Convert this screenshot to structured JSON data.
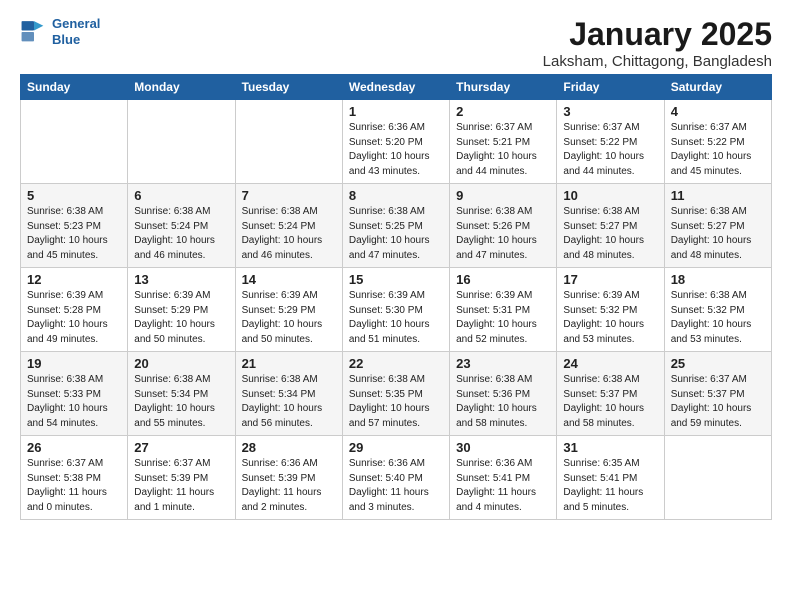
{
  "logo": {
    "line1": "General",
    "line2": "Blue"
  },
  "title": "January 2025",
  "subtitle": "Laksham, Chittagong, Bangladesh",
  "headers": [
    "Sunday",
    "Monday",
    "Tuesday",
    "Wednesday",
    "Thursday",
    "Friday",
    "Saturday"
  ],
  "weeks": [
    [
      {
        "day": "",
        "content": ""
      },
      {
        "day": "",
        "content": ""
      },
      {
        "day": "",
        "content": ""
      },
      {
        "day": "1",
        "content": "Sunrise: 6:36 AM\nSunset: 5:20 PM\nDaylight: 10 hours\nand 43 minutes."
      },
      {
        "day": "2",
        "content": "Sunrise: 6:37 AM\nSunset: 5:21 PM\nDaylight: 10 hours\nand 44 minutes."
      },
      {
        "day": "3",
        "content": "Sunrise: 6:37 AM\nSunset: 5:22 PM\nDaylight: 10 hours\nand 44 minutes."
      },
      {
        "day": "4",
        "content": "Sunrise: 6:37 AM\nSunset: 5:22 PM\nDaylight: 10 hours\nand 45 minutes."
      }
    ],
    [
      {
        "day": "5",
        "content": "Sunrise: 6:38 AM\nSunset: 5:23 PM\nDaylight: 10 hours\nand 45 minutes."
      },
      {
        "day": "6",
        "content": "Sunrise: 6:38 AM\nSunset: 5:24 PM\nDaylight: 10 hours\nand 46 minutes."
      },
      {
        "day": "7",
        "content": "Sunrise: 6:38 AM\nSunset: 5:24 PM\nDaylight: 10 hours\nand 46 minutes."
      },
      {
        "day": "8",
        "content": "Sunrise: 6:38 AM\nSunset: 5:25 PM\nDaylight: 10 hours\nand 47 minutes."
      },
      {
        "day": "9",
        "content": "Sunrise: 6:38 AM\nSunset: 5:26 PM\nDaylight: 10 hours\nand 47 minutes."
      },
      {
        "day": "10",
        "content": "Sunrise: 6:38 AM\nSunset: 5:27 PM\nDaylight: 10 hours\nand 48 minutes."
      },
      {
        "day": "11",
        "content": "Sunrise: 6:38 AM\nSunset: 5:27 PM\nDaylight: 10 hours\nand 48 minutes."
      }
    ],
    [
      {
        "day": "12",
        "content": "Sunrise: 6:39 AM\nSunset: 5:28 PM\nDaylight: 10 hours\nand 49 minutes."
      },
      {
        "day": "13",
        "content": "Sunrise: 6:39 AM\nSunset: 5:29 PM\nDaylight: 10 hours\nand 50 minutes."
      },
      {
        "day": "14",
        "content": "Sunrise: 6:39 AM\nSunset: 5:29 PM\nDaylight: 10 hours\nand 50 minutes."
      },
      {
        "day": "15",
        "content": "Sunrise: 6:39 AM\nSunset: 5:30 PM\nDaylight: 10 hours\nand 51 minutes."
      },
      {
        "day": "16",
        "content": "Sunrise: 6:39 AM\nSunset: 5:31 PM\nDaylight: 10 hours\nand 52 minutes."
      },
      {
        "day": "17",
        "content": "Sunrise: 6:39 AM\nSunset: 5:32 PM\nDaylight: 10 hours\nand 53 minutes."
      },
      {
        "day": "18",
        "content": "Sunrise: 6:38 AM\nSunset: 5:32 PM\nDaylight: 10 hours\nand 53 minutes."
      }
    ],
    [
      {
        "day": "19",
        "content": "Sunrise: 6:38 AM\nSunset: 5:33 PM\nDaylight: 10 hours\nand 54 minutes."
      },
      {
        "day": "20",
        "content": "Sunrise: 6:38 AM\nSunset: 5:34 PM\nDaylight: 10 hours\nand 55 minutes."
      },
      {
        "day": "21",
        "content": "Sunrise: 6:38 AM\nSunset: 5:34 PM\nDaylight: 10 hours\nand 56 minutes."
      },
      {
        "day": "22",
        "content": "Sunrise: 6:38 AM\nSunset: 5:35 PM\nDaylight: 10 hours\nand 57 minutes."
      },
      {
        "day": "23",
        "content": "Sunrise: 6:38 AM\nSunset: 5:36 PM\nDaylight: 10 hours\nand 58 minutes."
      },
      {
        "day": "24",
        "content": "Sunrise: 6:38 AM\nSunset: 5:37 PM\nDaylight: 10 hours\nand 58 minutes."
      },
      {
        "day": "25",
        "content": "Sunrise: 6:37 AM\nSunset: 5:37 PM\nDaylight: 10 hours\nand 59 minutes."
      }
    ],
    [
      {
        "day": "26",
        "content": "Sunrise: 6:37 AM\nSunset: 5:38 PM\nDaylight: 11 hours\nand 0 minutes."
      },
      {
        "day": "27",
        "content": "Sunrise: 6:37 AM\nSunset: 5:39 PM\nDaylight: 11 hours\nand 1 minute."
      },
      {
        "day": "28",
        "content": "Sunrise: 6:36 AM\nSunset: 5:39 PM\nDaylight: 11 hours\nand 2 minutes."
      },
      {
        "day": "29",
        "content": "Sunrise: 6:36 AM\nSunset: 5:40 PM\nDaylight: 11 hours\nand 3 minutes."
      },
      {
        "day": "30",
        "content": "Sunrise: 6:36 AM\nSunset: 5:41 PM\nDaylight: 11 hours\nand 4 minutes."
      },
      {
        "day": "31",
        "content": "Sunrise: 6:35 AM\nSunset: 5:41 PM\nDaylight: 11 hours\nand 5 minutes."
      },
      {
        "day": "",
        "content": ""
      }
    ]
  ]
}
